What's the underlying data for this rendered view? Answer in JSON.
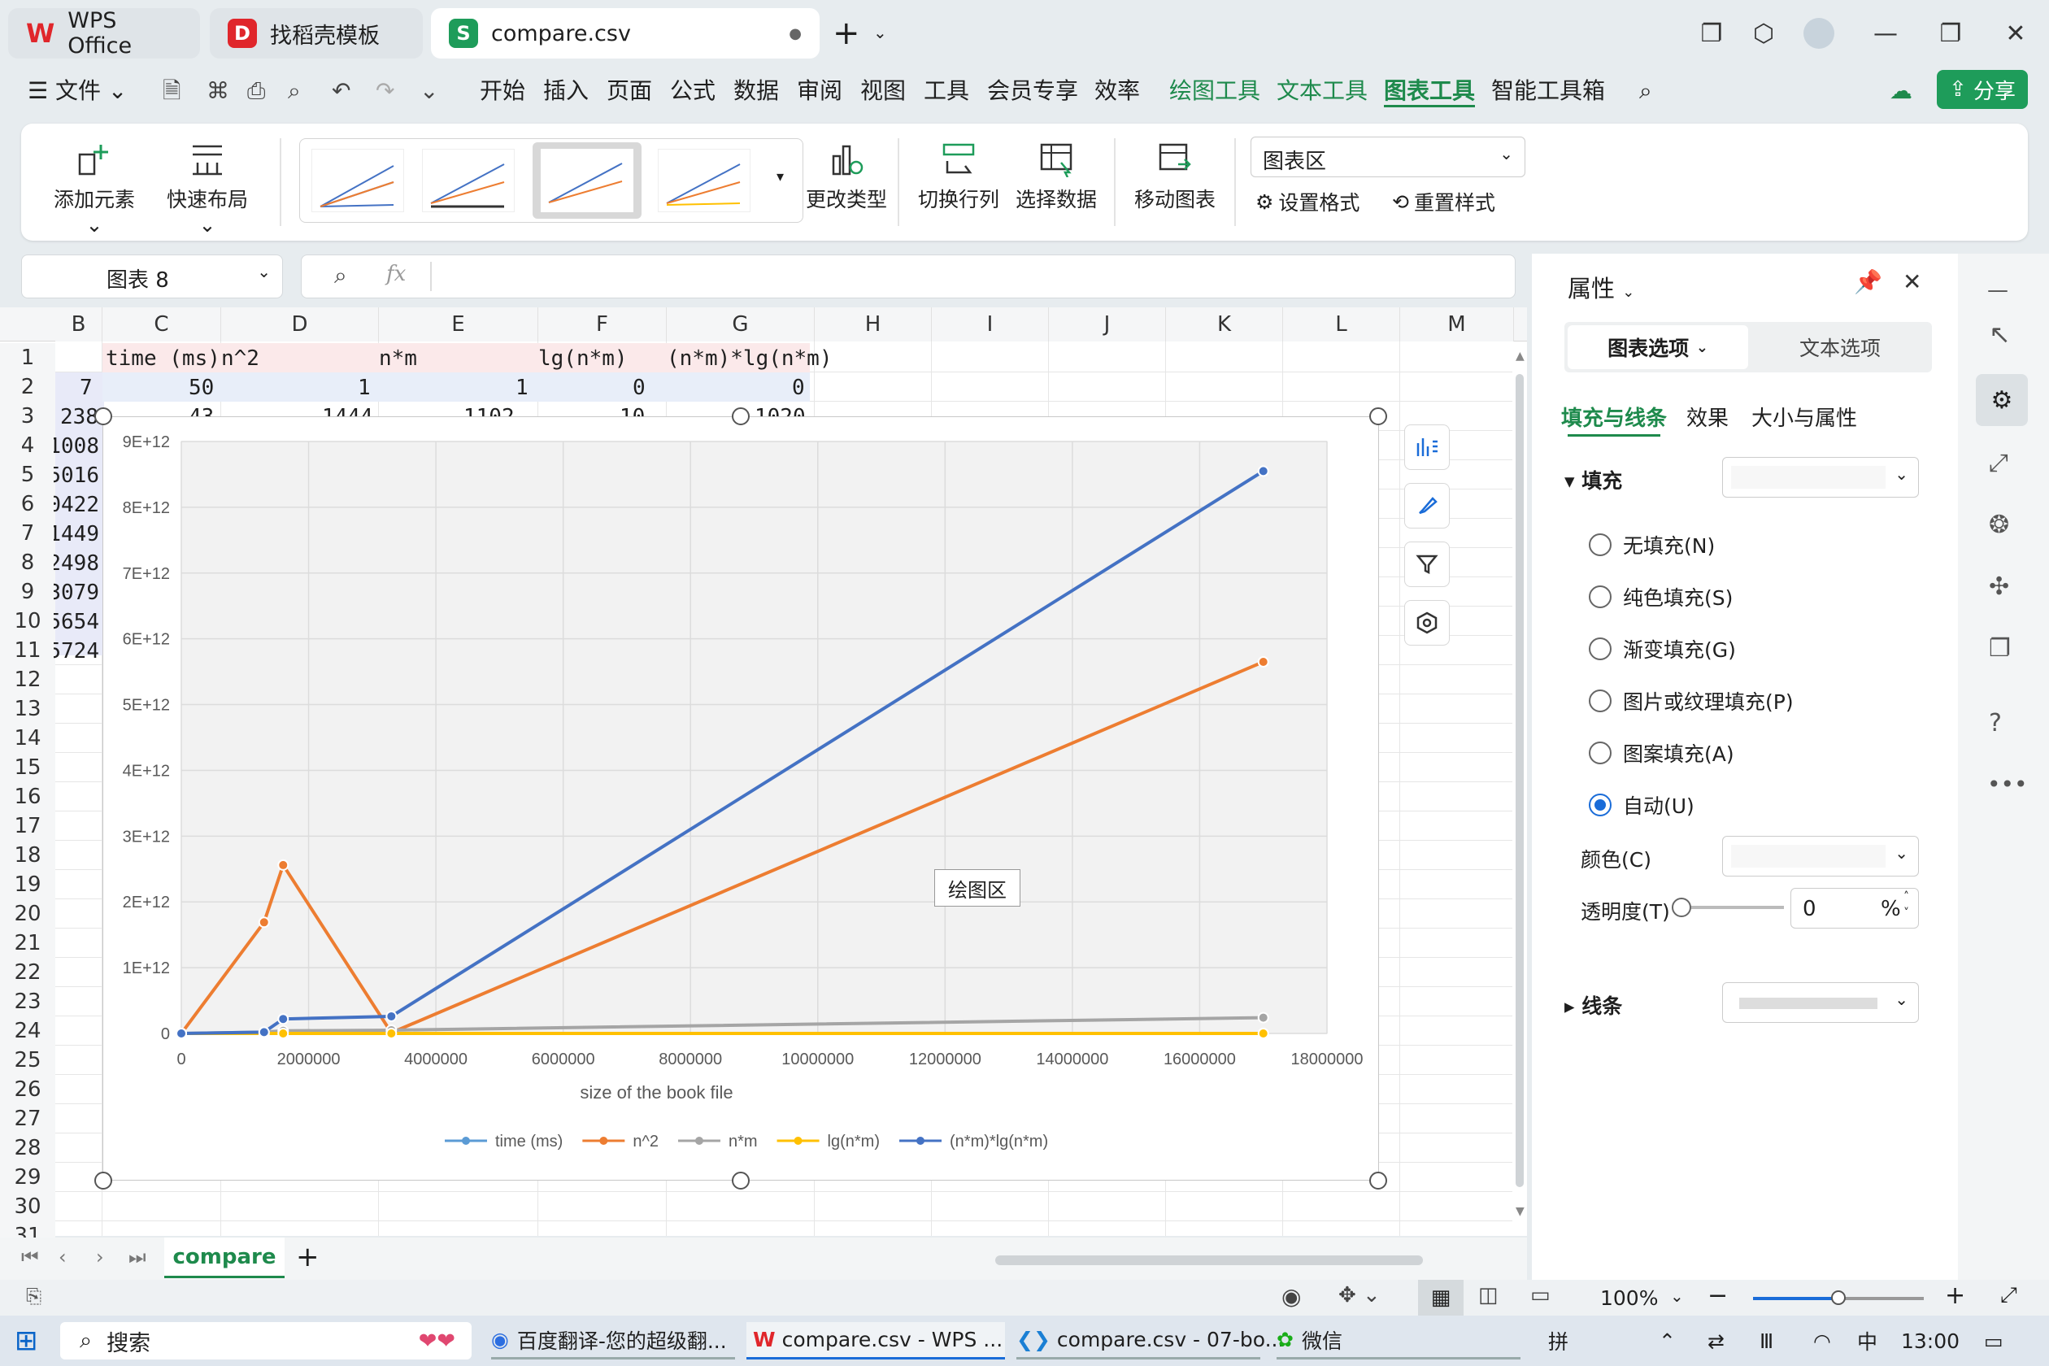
{
  "titlebar": {
    "tabs": [
      {
        "label": "WPS Office"
      },
      {
        "label": "找稻壳模板"
      },
      {
        "label": "compare.csv"
      }
    ],
    "new_tab": "+"
  },
  "menubar": {
    "file": "文件",
    "items": [
      "开始",
      "插入",
      "页面",
      "公式",
      "数据",
      "审阅",
      "视图",
      "工具",
      "会员专享",
      "效率",
      "绘图工具",
      "文本工具",
      "图表工具",
      "智能工具箱"
    ],
    "share": "分享"
  },
  "ribbon": {
    "add_element": "添加元素",
    "quick_layout": "快速布局",
    "change_type": "更改类型",
    "switch_rowcol": "切换行列",
    "select_data": "选择数据",
    "move_chart": "移动图表",
    "area_select": "图表区",
    "set_format": "设置格式",
    "reset_style": "重置样式"
  },
  "formula": {
    "name_box": "图表 8",
    "fx": "fx"
  },
  "sheet": {
    "columns": [
      "B",
      "C",
      "D",
      "E",
      "F",
      "G",
      "H",
      "I",
      "J",
      "K",
      "L",
      "M"
    ],
    "rows": [
      "1",
      "2",
      "3",
      "4",
      "5",
      "6",
      "7",
      "8",
      "9",
      "10",
      "11",
      "12",
      "13",
      "14",
      "15",
      "16",
      "17",
      "18",
      "19",
      "20",
      "21",
      "22",
      "23",
      "24",
      "25",
      "26",
      "27",
      "28",
      "29",
      "30",
      "31"
    ],
    "header_cells": [
      "time (ms)",
      "n^2",
      "n*m",
      "lg(n*m)",
      "(n*m)*lg(n*m)"
    ],
    "row2": [
      "7",
      "50",
      "1",
      "1",
      "0",
      "0"
    ],
    "row3": [
      "238",
      "43",
      "1444",
      "1102",
      "10",
      "1020"
    ],
    "colB": [
      "1008",
      "5016",
      "0422",
      "1449",
      "2498",
      "3079",
      "5654",
      "5724"
    ],
    "tab_name": "compare",
    "add_sheet": "+"
  },
  "chart_data": {
    "type": "line",
    "title": "",
    "xlabel": "size of the book file",
    "ylabel": "",
    "xlim": [
      0,
      18000000
    ],
    "ylim": [
      0,
      9000000000000
    ],
    "x_ticks": [
      "0",
      "2000000",
      "4000000",
      "6000000",
      "8000000",
      "10000000",
      "12000000",
      "14000000",
      "16000000",
      "18000000"
    ],
    "y_ticks": [
      "0",
      "1E+12",
      "2E+12",
      "3E+12",
      "4E+12",
      "5E+12",
      "6E+12",
      "7E+12",
      "8E+12",
      "9E+12"
    ],
    "legend_position": "bottom",
    "plot_area_label": "绘图区",
    "series": [
      {
        "name": "time (ms)",
        "color": "#5b9bd5",
        "points": [
          [
            50,
            7
          ],
          [
            100,
            238
          ],
          [
            1300000,
            1008
          ],
          [
            1600000,
            5016
          ],
          [
            3300000,
            10422
          ],
          [
            17000000,
            25724
          ]
        ]
      },
      {
        "name": "n^2",
        "color": "#ed7d31",
        "points": [
          [
            50,
            1
          ],
          [
            100,
            1444
          ],
          [
            1300000,
            1690000000000
          ],
          [
            1600000,
            2560000000000
          ],
          [
            3300000,
            10890000000
          ],
          [
            17000000,
            5650000000000
          ]
        ]
      },
      {
        "name": "n*m",
        "color": "#a5a5a5",
        "points": [
          [
            50,
            1
          ],
          [
            100,
            1102
          ],
          [
            1300000,
            20000000000
          ],
          [
            1600000,
            40000000000
          ],
          [
            3300000,
            50000000000
          ],
          [
            17000000,
            240000000000
          ]
        ]
      },
      {
        "name": "lg(n*m)",
        "color": "#ffc000",
        "points": [
          [
            50,
            0
          ],
          [
            100,
            10
          ],
          [
            1300000,
            30
          ],
          [
            1600000,
            32
          ],
          [
            3300000,
            35
          ],
          [
            17000000,
            40
          ]
        ]
      },
      {
        "name": "(n*m)*lg(n*m)",
        "color": "#4472c4",
        "points": [
          [
            50,
            0
          ],
          [
            100,
            1020
          ],
          [
            1300000,
            20000000000
          ],
          [
            1600000,
            220000000000
          ],
          [
            3300000,
            260000000000
          ],
          [
            17000000,
            8550000000000
          ]
        ]
      }
    ]
  },
  "panel": {
    "title": "属性",
    "tab_chart": "图表选项",
    "tab_text": "文本选项",
    "subtabs": [
      "填充与线条",
      "效果",
      "大小与属性"
    ],
    "fill_label": "填充",
    "fill_options": [
      "无填充(N)",
      "纯色填充(S)",
      "渐变填充(G)",
      "图片或纹理填充(P)",
      "图案填充(A)",
      "自动(U)"
    ],
    "color_label": "颜色(C)",
    "transparency_label": "透明度(T)",
    "transparency_value": "0",
    "percent": "%",
    "line_label": "线条"
  },
  "status": {
    "zoom": "100%"
  },
  "taskbar": {
    "search": "搜索",
    "apps": [
      "百度翻译-您的超级翻...",
      "compare.csv - WPS ...",
      "compare.csv - 07-bo...",
      "微信"
    ],
    "ime": "拼",
    "lang": "中",
    "time": "13:00"
  }
}
